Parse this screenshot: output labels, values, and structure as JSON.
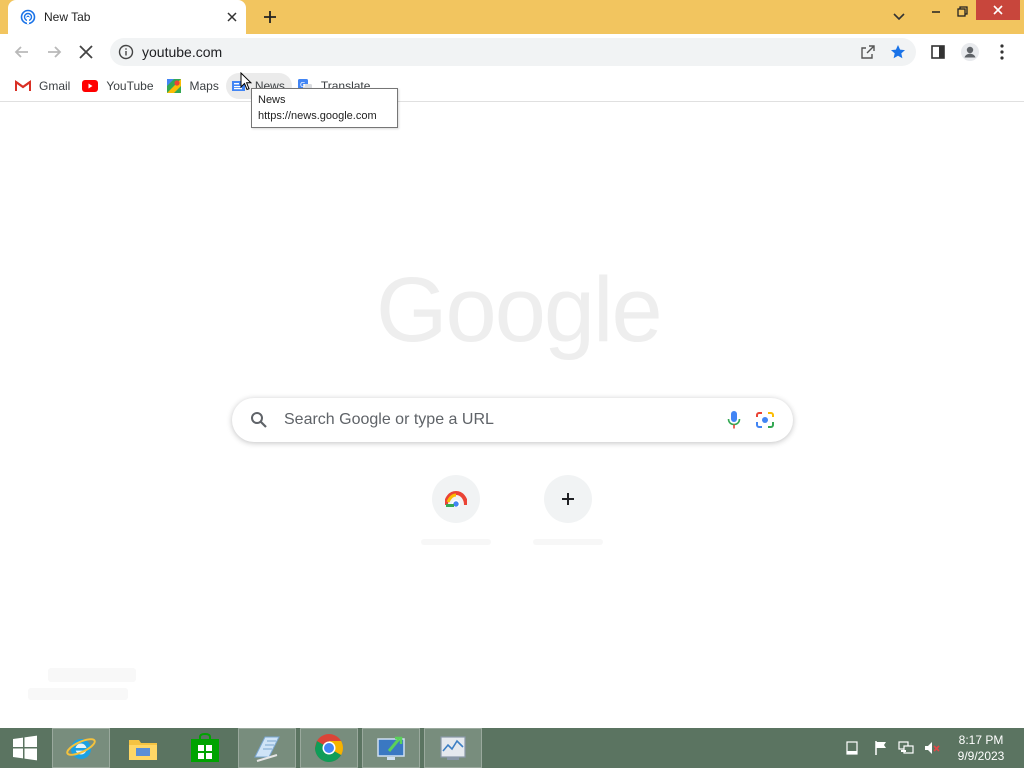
{
  "browser": {
    "tab": {
      "title": "New Tab"
    },
    "address": {
      "url": "youtube.com"
    },
    "bookmarks": [
      {
        "label": "Gmail",
        "icon": "gmail-icon"
      },
      {
        "label": "YouTube",
        "icon": "youtube-icon"
      },
      {
        "label": "Maps",
        "icon": "maps-icon"
      },
      {
        "label": "News",
        "icon": "news-icon"
      },
      {
        "label": "Translate",
        "icon": "translate-icon"
      }
    ],
    "tooltip": {
      "title": "News",
      "url": "https://news.google.com"
    }
  },
  "newtab": {
    "logo": "Google",
    "search": {
      "placeholder": "Search Google or type a URL"
    },
    "shortcuts": [
      {
        "icon": "chrome-web-store-icon"
      },
      {
        "icon": "add-shortcut-icon"
      }
    ]
  },
  "taskbar": {
    "apps": [
      {
        "icon": "windows-start-icon"
      },
      {
        "icon": "internet-explorer-icon"
      },
      {
        "icon": "file-explorer-icon"
      },
      {
        "icon": "store-icon"
      },
      {
        "icon": "notepad-icon"
      },
      {
        "icon": "chrome-icon"
      },
      {
        "icon": "remote-desktop-icon"
      },
      {
        "icon": "task-manager-icon"
      }
    ],
    "clock": {
      "time": "8:17 PM",
      "date": "9/9/2023"
    }
  },
  "colors": {
    "tabstrip": "#f2c55f",
    "taskbar": "#5b7461",
    "close": "#c8463c",
    "accent": "#1a73e8"
  }
}
